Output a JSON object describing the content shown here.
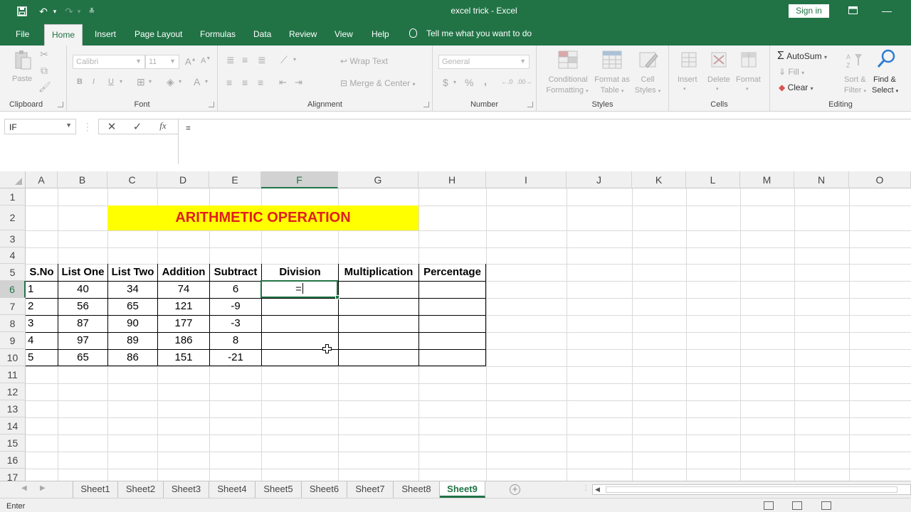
{
  "title_bar": {
    "title": "excel trick  -  Excel",
    "sign_in": "Sign in"
  },
  "ribbon_tabs": [
    "File",
    "Home",
    "Insert",
    "Page Layout",
    "Formulas",
    "Data",
    "Review",
    "View",
    "Help"
  ],
  "active_tab": "Home",
  "tell_me": "Tell me what you want to do",
  "ribbon": {
    "clipboard": {
      "label": "Clipboard",
      "paste": "Paste"
    },
    "font": {
      "label": "Font",
      "font_name": "Calibri",
      "font_size": "11",
      "bold": "B",
      "italic": "I",
      "underline": "U"
    },
    "alignment": {
      "label": "Alignment",
      "wrap_text": "Wrap Text",
      "merge_center": "Merge & Center"
    },
    "number": {
      "label": "Number",
      "format": "General",
      "currency": "$",
      "percent": "%",
      "comma": ","
    },
    "styles": {
      "label": "Styles",
      "conditional1": "Conditional",
      "conditional2": "Formatting",
      "format_as1": "Format as",
      "format_as2": "Table",
      "cell_styles1": "Cell",
      "cell_styles2": "Styles"
    },
    "cells": {
      "label": "Cells",
      "insert": "Insert",
      "delete": "Delete",
      "format": "Format"
    },
    "editing": {
      "label": "Editing",
      "autosum": "AutoSum",
      "fill": "Fill",
      "clear": "Clear",
      "sort1": "Sort &",
      "sort2": "Filter",
      "find1": "Find &",
      "find2": "Select"
    }
  },
  "formula_bar": {
    "name_box": "IF",
    "formula": "="
  },
  "columns": [
    "A",
    "B",
    "C",
    "D",
    "E",
    "F",
    "G",
    "H",
    "I",
    "J",
    "K",
    "L",
    "M",
    "N",
    "O"
  ],
  "rows": [
    "1",
    "2",
    "3",
    "4",
    "5",
    "6",
    "7",
    "8",
    "9",
    "10",
    "11",
    "12",
    "13",
    "14",
    "15",
    "16",
    "17"
  ],
  "sheet": {
    "title": "ARITHMETIC OPERATION",
    "headers": [
      "S.No",
      "List One",
      "List Two",
      "Addition",
      "Subtract",
      "Division",
      "Multiplication",
      "Percentage"
    ],
    "data": [
      [
        "1",
        "40",
        "34",
        "74",
        "6"
      ],
      [
        "2",
        "56",
        "65",
        "121",
        "-9"
      ],
      [
        "3",
        "87",
        "90",
        "177",
        "-3"
      ],
      [
        "4",
        "97",
        "89",
        "186",
        "8"
      ],
      [
        "5",
        "65",
        "86",
        "151",
        "-21"
      ]
    ],
    "active_cell_value": "="
  },
  "sheet_tabs": [
    "Sheet1",
    "Sheet2",
    "Sheet3",
    "Sheet4",
    "Sheet5",
    "Sheet6",
    "Sheet7",
    "Sheet8",
    "Sheet9"
  ],
  "active_sheet": "Sheet9",
  "status": "Enter",
  "colors": {
    "accent": "#217346",
    "title_fill": "#ffff00",
    "title_text": "#e01e1e"
  }
}
